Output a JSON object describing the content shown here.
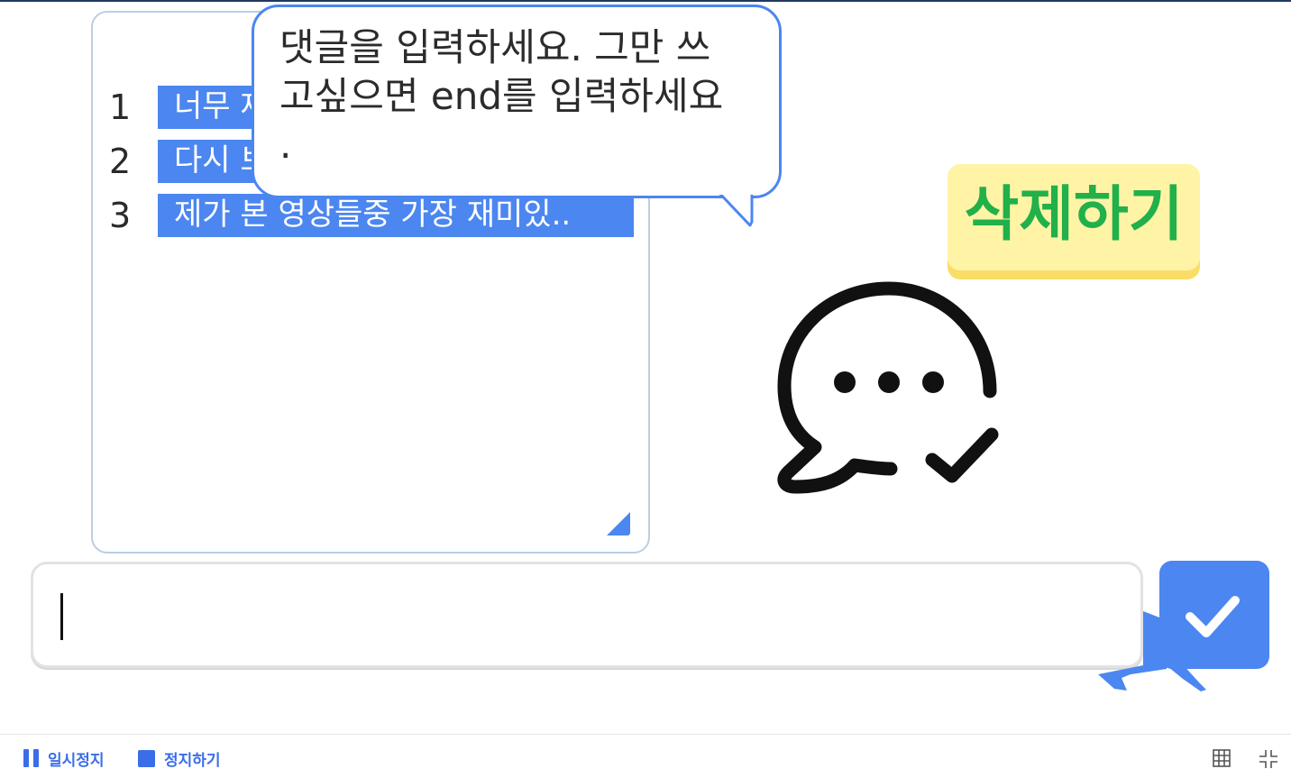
{
  "comment_list": {
    "rows": [
      {
        "index": "1",
        "text": "너무 재미있어요"
      },
      {
        "index": "2",
        "text": "다시 보고 싶어요"
      },
      {
        "index": "3",
        "text": "제가 본 영상들중 가장 재미있.."
      }
    ]
  },
  "speech_bubble": {
    "text": "댓글을 입력하세요. 그만 쓰\n고싶으면 end를 입력하세요\n."
  },
  "delete_button": {
    "label": "삭제하기",
    "text_color": "#21b04a",
    "bg_color": "#fff3a6"
  },
  "chat_icon": {
    "name": "chat-bubble-check-icon"
  },
  "comment_input": {
    "value": ""
  },
  "send_button": {
    "icon": "check-icon",
    "color": "#4c86f0"
  },
  "toolbar": {
    "pause_label": "일시정지",
    "stop_label": "정지하기",
    "accent_color": "#3a6ee8"
  }
}
